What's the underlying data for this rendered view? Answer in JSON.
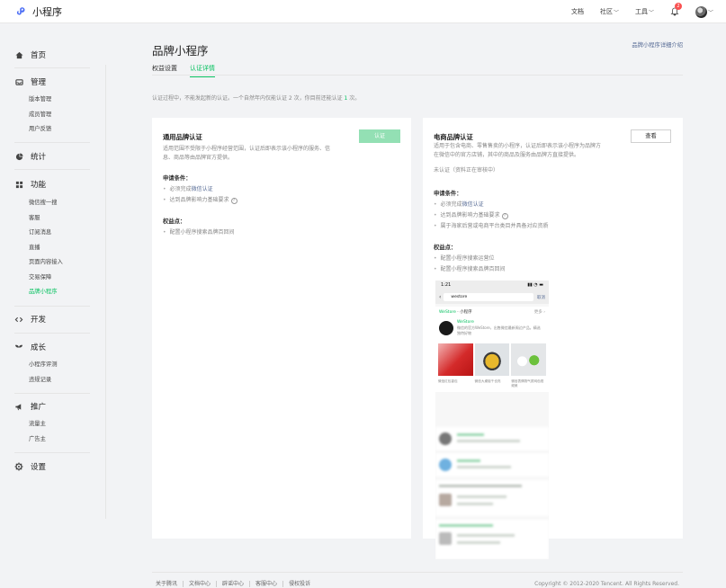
{
  "header": {
    "app_name": "小程序",
    "nav": [
      {
        "label": "文档",
        "has_dropdown": false
      },
      {
        "label": "社区",
        "has_dropdown": true
      },
      {
        "label": "工具",
        "has_dropdown": true
      }
    ],
    "notification_count": "2"
  },
  "sidebar": {
    "home": "首页",
    "manage": {
      "label": "管理",
      "items": [
        "版本管理",
        "成员管理",
        "用户反馈"
      ]
    },
    "stats": "统计",
    "features": {
      "label": "功能",
      "items": [
        "微信搜一搜",
        "客服",
        "订阅消息",
        "直播",
        "页面内容接入",
        "交易保障",
        "品牌小程序"
      ],
      "active_index": 6
    },
    "develop": "开发",
    "growth": {
      "label": "成长",
      "items": [
        "小程序评测",
        "违规记录"
      ]
    },
    "promote": {
      "label": "推广",
      "items": [
        "流量主",
        "广告主"
      ]
    },
    "settings": "设置"
  },
  "main": {
    "title": "品牌小程序",
    "intro_link": "品牌小程序详细介绍",
    "tabs": [
      {
        "label": "权益设置",
        "active": false
      },
      {
        "label": "认证详情",
        "active": true
      }
    ],
    "notice": {
      "prefix": "认证过程中，不能发起新的认证。一个自然年内仅能认证 2 次，你目前还能认证 ",
      "count": "1",
      "suffix": " 次。"
    }
  },
  "card_general": {
    "title": "通用品牌认证",
    "button": "认证",
    "desc_1": "适用范围不受限于小程序经营范围，认证后即表示该小程序的服务、信",
    "desc_2": "息、商品等由品牌官方提供。",
    "conditions_title": "申请条件：",
    "cond_1_prefix": "必须完成",
    "cond_1_link": "微信认证",
    "cond_2": "达到品牌影响力基础要求",
    "benefits_title": "权益点：",
    "benefit_1": "配置小程序搜索品牌百回间"
  },
  "card_ecommerce": {
    "title": "电商品牌认证",
    "button": "查看",
    "desc_1": "适用于包含电商、零售售卖的小程序，认证后即表示该小程序为品牌方",
    "desc_2": "在微信中的官方店铺，其中的商品及服务由品牌方直接提供。",
    "status": "未认证（资料正在审核中）",
    "conditions_title": "申请条件：",
    "cond_1_prefix": "必须完成",
    "cond_1_link": "微信认证",
    "cond_2": "达到品牌影响力基础要求",
    "cond_3": "属于海家后营或电商平台类目并具备对应资质",
    "benefits_title": "权益点：",
    "benefit_1": "配置小程序搜索运营位",
    "benefit_2": "配置小程序搜索品牌百回间"
  },
  "phone": {
    "time": "1:21",
    "signal": "▮▮ ◔ ▬",
    "query": "westore",
    "cancel": "取消",
    "section_brand": "WeStore",
    "section_rest": " · 小程序",
    "more": "更多 ›",
    "brand_name": "WeStore",
    "brand_desc": "微信的官方WeStore，出售微信最新周边产品。精选独特好物",
    "products": [
      "微信红包香包",
      "微信大桌毯千也亮",
      "微信表情物气质网色视频美"
    ]
  },
  "footer": {
    "links": [
      "关于腾讯",
      "文档中心",
      "辟谣中心",
      "客服中心",
      "侵权投诉"
    ],
    "copyright": "Copyright © 2012-2020 Tencent. All Rights Reserved."
  },
  "colors": {
    "accent": "#07c160",
    "link": "#576b95",
    "badge": "#fa5151",
    "disabled_button": "#93e0b4"
  }
}
